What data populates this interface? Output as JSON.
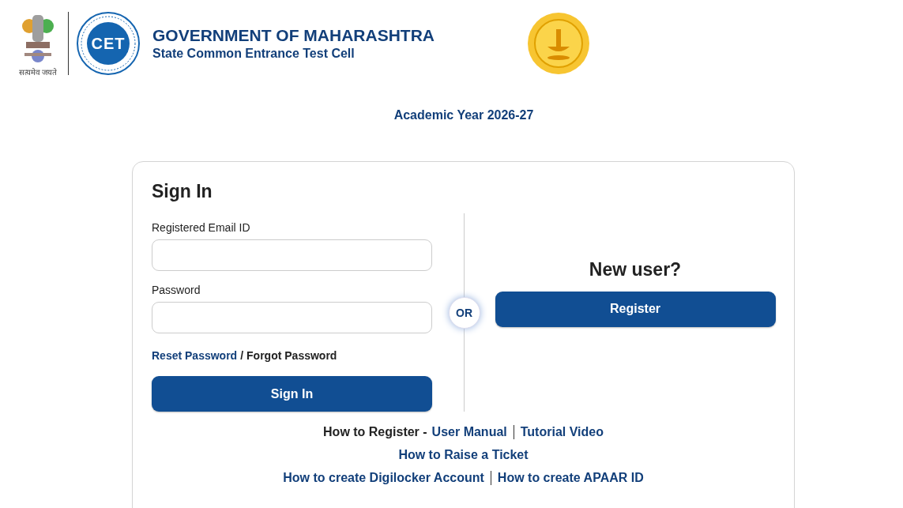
{
  "header": {
    "emblem_motto": "सत्यमेव जयते",
    "cet_logo_text": "CET",
    "title": "GOVERNMENT OF MAHARASHTRA",
    "subtitle": "State Common Entrance Test Cell"
  },
  "academic_year": "Academic Year 2026-27",
  "sign_in": {
    "title": "Sign In",
    "fields": [
      {
        "label": "Registered Email ID"
      },
      {
        "label": "Password"
      }
    ],
    "reset_link": "Reset Password",
    "separator": "/",
    "forgot_link": "Forgot Password",
    "button": "Sign In"
  },
  "divider_label": "OR",
  "new_user": {
    "title": "New user?",
    "button": "Register"
  },
  "help_links": [
    {
      "prefix": "How to Register -",
      "links": [
        "User Manual",
        "Tutorial Video"
      ]
    },
    {
      "links": [
        "How to Raise a Ticket"
      ]
    },
    {
      "links": [
        "How to create Digilocker Account",
        "How to create APAAR ID"
      ]
    }
  ]
}
